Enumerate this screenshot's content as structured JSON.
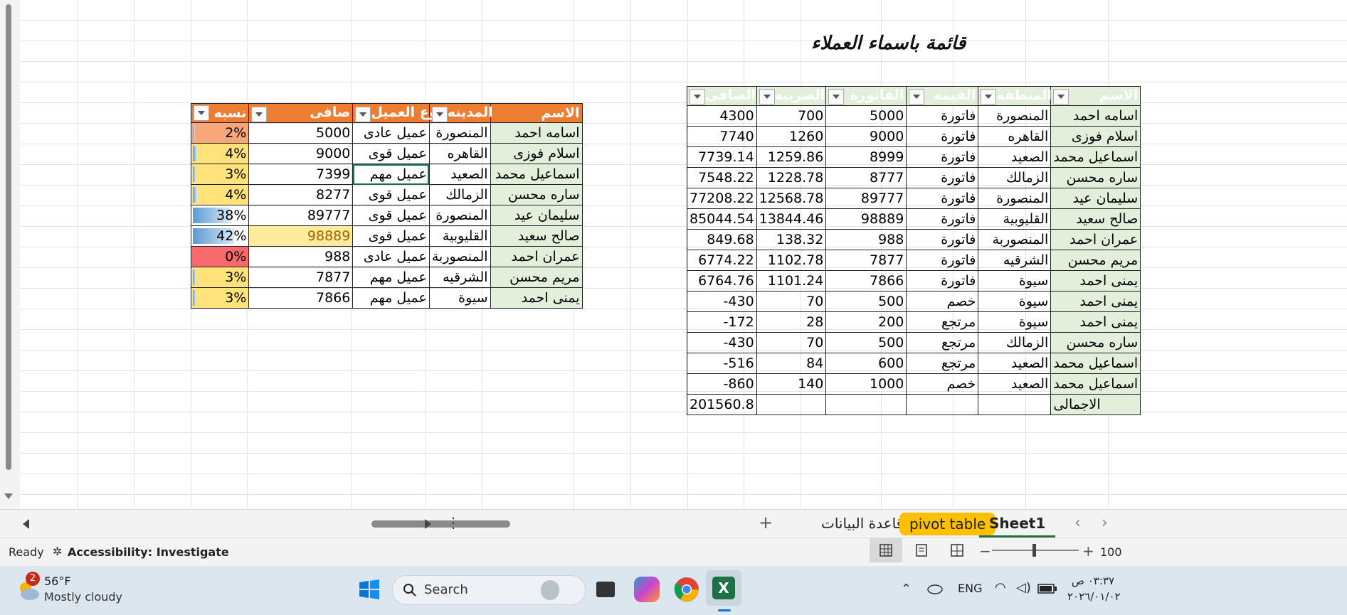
{
  "sheet": {
    "title": "قائمة باسماء العملاء",
    "orange_table": {
      "headers": [
        "الاسم",
        "المدينه",
        "نوع العميل",
        "صافى",
        "نسبه"
      ],
      "rows": [
        {
          "name": "اسامه احمد",
          "city": "المنصورة",
          "type": "عميل عادى",
          "net": "5000",
          "pct": "2%",
          "bar": 0.02
        },
        {
          "name": "اسلام فوزى",
          "city": "القاهره",
          "type": "عميل قوى",
          "net": "9000",
          "pct": "4%",
          "bar": 0.04
        },
        {
          "name": "اسماعيل محمد",
          "city": "الصعيد",
          "type": "عميل مهم",
          "net": "7399",
          "pct": "3%",
          "bar": 0.03
        },
        {
          "name": "ساره محسن",
          "city": "الزمالك",
          "type": "عميل قوى",
          "net": "8277",
          "pct": "4%",
          "bar": 0.04
        },
        {
          "name": "سليمان عيد",
          "city": "المنصورة",
          "type": "عميل قوى",
          "net": "89777",
          "pct": "38%",
          "bar": 0.38
        },
        {
          "name": "صالح سعيد",
          "city": "القليوبية",
          "type": "عميل قوى",
          "net": "98889",
          "pct": "42%",
          "bar": 0.42
        },
        {
          "name": "عمران احمد",
          "city": "المنصوربة",
          "type": "عميل عادى",
          "net": "988",
          "pct": "0%",
          "bar": 0.0
        },
        {
          "name": "مريم محسن",
          "city": "الشرقيه",
          "type": "عميل مهم",
          "net": "7877",
          "pct": "3%",
          "bar": 0.03
        },
        {
          "name": "يمنى احمد",
          "city": "سيوة",
          "type": "عميل مهم",
          "net": "7866",
          "pct": "3%",
          "bar": 0.03
        }
      ]
    },
    "green_table": {
      "headers": [
        "الاسم",
        "المنطقه",
        "القيمه",
        "الفاتورة",
        "الضريبه",
        "الصافى"
      ],
      "rows": [
        {
          "name": "اسامه احمد",
          "region": "المنصورة",
          "kind": "فاتورة",
          "invoice": "5000",
          "tax": "700",
          "net": "4300"
        },
        {
          "name": "اسلام فوزى",
          "region": "القاهره",
          "kind": "فاتورة",
          "invoice": "9000",
          "tax": "1260",
          "net": "7740"
        },
        {
          "name": "اسماعيل محمد",
          "region": "الصعيد",
          "kind": "فاتورة",
          "invoice": "8999",
          "tax": "1259.86",
          "net": "7739.14"
        },
        {
          "name": "ساره محسن",
          "region": "الزمالك",
          "kind": "فاتورة",
          "invoice": "8777",
          "tax": "1228.78",
          "net": "7548.22"
        },
        {
          "name": "سليمان عيد",
          "region": "المنصورة",
          "kind": "فاتورة",
          "invoice": "89777",
          "tax": "12568.78",
          "net": "77208.22"
        },
        {
          "name": "صالح سعيد",
          "region": "القليوبية",
          "kind": "فاتورة",
          "invoice": "98889",
          "tax": "13844.46",
          "net": "85044.54"
        },
        {
          "name": "عمران احمد",
          "region": "المنصوربة",
          "kind": "فاتورة",
          "invoice": "988",
          "tax": "138.32",
          "net": "849.68"
        },
        {
          "name": "مريم محسن",
          "region": "الشرقيه",
          "kind": "فاتورة",
          "invoice": "7877",
          "tax": "1102.78",
          "net": "6774.22"
        },
        {
          "name": "يمنى احمد",
          "region": "سيوة",
          "kind": "فاتورة",
          "invoice": "7866",
          "tax": "1101.24",
          "net": "6764.76"
        },
        {
          "name": "يمنى احمد",
          "region": "سيوة",
          "kind": "خصم",
          "invoice": "500",
          "tax": "70",
          "net": "-430"
        },
        {
          "name": "يمنى احمد",
          "region": "سيوة",
          "kind": "مرتجع",
          "invoice": "200",
          "tax": "28",
          "net": "-172"
        },
        {
          "name": "ساره محسن",
          "region": "الزمالك",
          "kind": "مرتجع",
          "invoice": "500",
          "tax": "70",
          "net": "-430"
        },
        {
          "name": "اسماعيل محمد",
          "region": "الصعيد",
          "kind": "مرتجع",
          "invoice": "600",
          "tax": "84",
          "net": "-516"
        },
        {
          "name": "اسماعيل محمد",
          "region": "الصعيد",
          "kind": "خصم",
          "invoice": "1000",
          "tax": "140",
          "net": "-860"
        }
      ],
      "total_label": "الاجمالى",
      "total_value": "201560.8"
    }
  },
  "tabs": {
    "add": "+",
    "items": [
      "قاعدة البيانات",
      "pivot table",
      "Sheet1"
    ]
  },
  "status": {
    "ready": "Ready",
    "accessibility": "Accessibility: Investigate",
    "zoom": "100"
  },
  "taskbar": {
    "weather_badge": "2",
    "temperature": "56°F",
    "condition": "Mostly cloudy",
    "search": "Search",
    "lang": "ENG",
    "time": "٠٣:٣٧ ص",
    "date": "٢٠٢٦/٠١/٠٢"
  },
  "colors": {
    "orange": "#ed7d31",
    "green_fill": "#e2efda",
    "tab_yellow": "#ffc000",
    "excel_green": "#1e7145"
  }
}
